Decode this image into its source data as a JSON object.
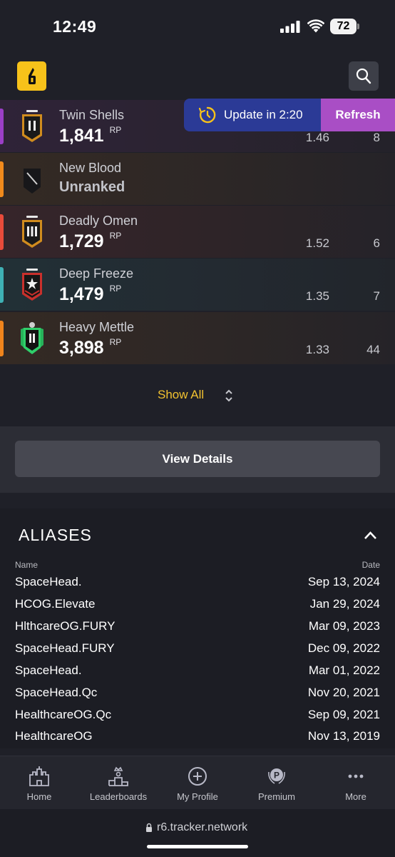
{
  "status_bar": {
    "time": "12:49",
    "battery": "72"
  },
  "update_banner": {
    "text": "Update in 2:20",
    "refresh_label": "Refresh"
  },
  "ranks": [
    {
      "season": "Twin Shells",
      "rp": "1,841",
      "rp_unit": "RP",
      "kd": "1.46",
      "wins": "8",
      "accent": "#9b3fc7",
      "badge": "gold-badge-icon"
    },
    {
      "season": "New Blood",
      "status": "Unranked",
      "accent": "#f08a1c",
      "badge": "unranked-badge-icon"
    },
    {
      "season": "Deadly Omen",
      "rp": "1,729",
      "rp_unit": "RP",
      "kd": "1.52",
      "wins": "6",
      "accent": "#e84b3a",
      "badge": "gold-badge-icon"
    },
    {
      "season": "Deep Freeze",
      "rp": "1,479",
      "rp_unit": "RP",
      "kd": "1.35",
      "wins": "7",
      "accent": "#3fb1b5",
      "badge": "copper-badge-icon"
    },
    {
      "season": "Heavy Mettle",
      "rp": "3,898",
      "rp_unit": "RP",
      "kd": "1.33",
      "wins": "44",
      "accent": "#f0841c",
      "badge": "emerald-badge-icon"
    }
  ],
  "show_all_label": "Show All",
  "view_details_label": "View Details",
  "aliases": {
    "title": "ALIASES",
    "col_name": "Name",
    "col_date": "Date",
    "rows": [
      {
        "name": "SpaceHead.",
        "date": "Sep 13, 2024"
      },
      {
        "name": "HCOG.Elevate",
        "date": "Jan 29, 2024"
      },
      {
        "name": "HlthcareOG.FURY",
        "date": "Mar 09, 2023"
      },
      {
        "name": "SpaceHead.FURY",
        "date": "Dec 09, 2022"
      },
      {
        "name": "SpaceHead.",
        "date": "Mar 01, 2022"
      },
      {
        "name": "SpaceHead.Qc",
        "date": "Nov 20, 2021"
      },
      {
        "name": "HealthcareOG.Qc",
        "date": "Sep 09, 2021"
      },
      {
        "name": "HealthcareOG",
        "date": "Nov 13, 2019"
      }
    ]
  },
  "nav": [
    {
      "label": "Home",
      "icon": "castle-icon"
    },
    {
      "label": "Leaderboards",
      "icon": "podium-icon"
    },
    {
      "label": "My Profile",
      "icon": "add-circle-icon"
    },
    {
      "label": "Premium",
      "icon": "premium-laurel-icon"
    },
    {
      "label": "More",
      "icon": "more-dots-icon"
    }
  ],
  "url": "r6.tracker.network"
}
